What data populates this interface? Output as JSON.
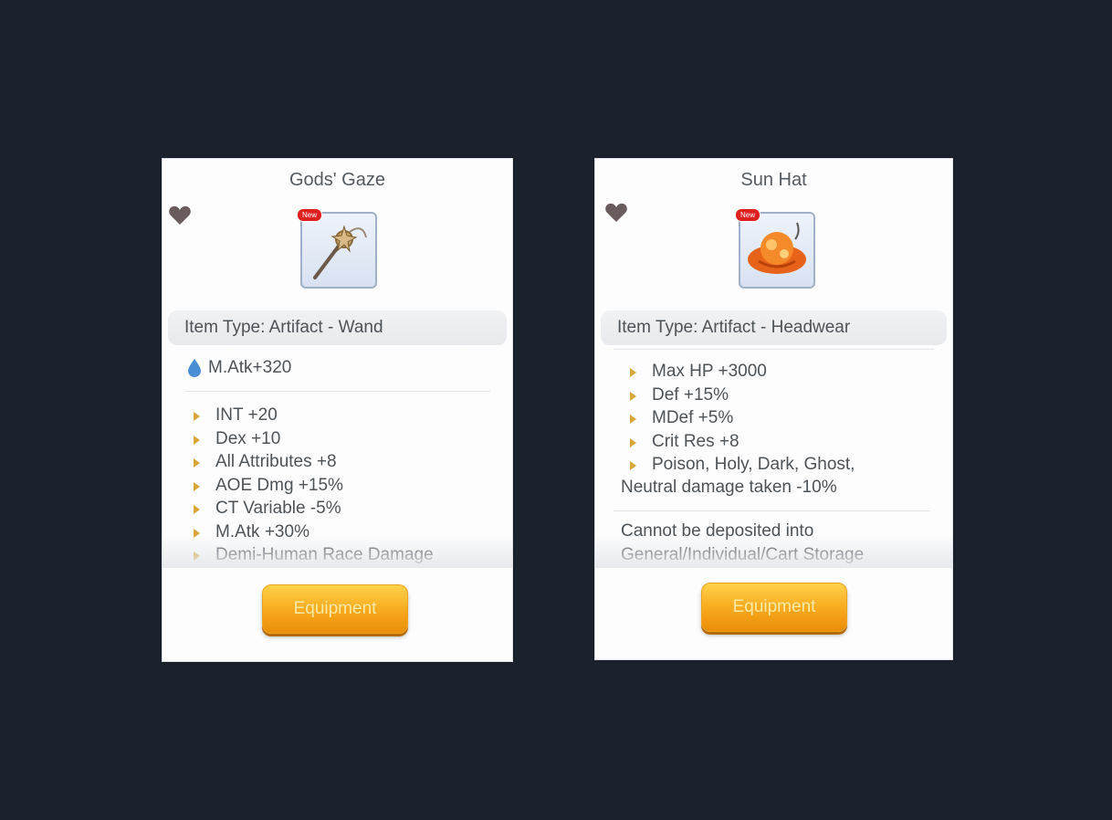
{
  "colors": {
    "background": "#1b222d",
    "card": "#fdfdfd",
    "button": "#f7a81c",
    "bullet": "#d9a63a",
    "badge": "#e02020"
  },
  "items": [
    {
      "name": "Gods' Gaze",
      "badge": "New",
      "icon": "wand-icon",
      "type": "Item Type: Artifact - Wand",
      "base_stat": "M.Atk+320",
      "stats": [
        "INT +20",
        "Dex +10",
        "All Attributes +8",
        "AOE Dmg +15%",
        "CT Variable -5%",
        "M.Atk +30%",
        "Demi-Human Race Damage"
      ],
      "button": "Equipment"
    },
    {
      "name": "Sun Hat",
      "badge": "New",
      "icon": "sun-hat-icon",
      "type": "Item Type: Artifact - Headwear",
      "stats": [
        "Max HP +3000",
        "Def +15%",
        "MDef +5%",
        "Crit Res +8",
        "Poison, Holy, Dark, Ghost,"
      ],
      "stats_tail": "Neutral damage taken -10%",
      "note_line1": "Cannot be deposited into",
      "note_line2": "General/Individual/Cart Storage",
      "button": "Equipment"
    }
  ]
}
